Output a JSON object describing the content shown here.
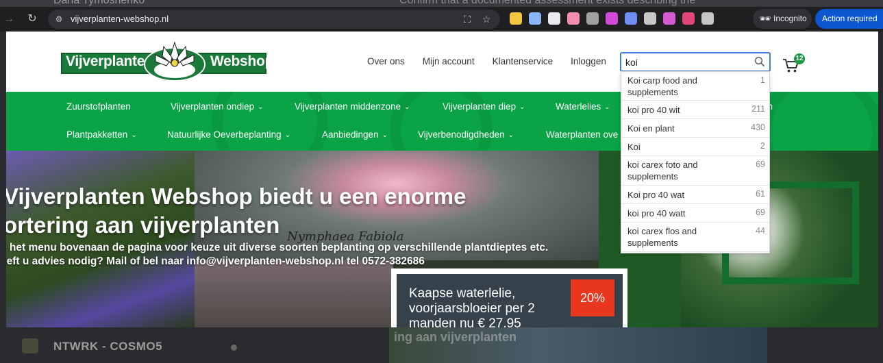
{
  "background": {
    "top_name": "Daria Tymoshenko",
    "top_snippet": "Confirm that a documented assessment exists describing the",
    "bottom_label": "NTWRK - COSMO5",
    "bottom_thumb_text": "ing aan vijverplanten"
  },
  "browser": {
    "url": "vijverplanten-webshop.nl",
    "incognito_label": "Incognito",
    "action_required_label": "Action required",
    "extension_colors": [
      "#f4c542",
      "#8ab4f8",
      "#e8eaed",
      "#f28cb1",
      "#a0a0a0",
      "#d24bd8",
      "#6f8df5",
      "#c6c6c6",
      "#d65ad1",
      "#e0457b",
      "#c6c6c6"
    ]
  },
  "header": {
    "logo_left": "Vijverplanten",
    "logo_right": "Webshop",
    "nav": {
      "about": "Over ons",
      "account": "Mijn account",
      "service": "Klantenservice",
      "login": "Inloggen"
    },
    "search_value": "koi",
    "cart_count": "12"
  },
  "menu": {
    "row1": [
      {
        "label": "Zuurstofplanten",
        "chevron": false
      },
      {
        "label": "Vijverplanten ondiep",
        "chevron": true
      },
      {
        "label": "Vijverplanten middenzone",
        "chevron": true
      },
      {
        "label": "Vijverplanten diep",
        "chevron": true
      },
      {
        "label": "Waterlelies",
        "chevron": true
      },
      {
        "label": "en",
        "chevron": false
      }
    ],
    "row2": [
      {
        "label": "Plantpakketten",
        "chevron": true
      },
      {
        "label": "Natuurlijke Oeverbeplanting",
        "chevron": true
      },
      {
        "label": "Aanbiedingen",
        "chevron": true
      },
      {
        "label": "Vijverbenodigdheden",
        "chevron": true
      },
      {
        "label": "Waterplanten ove",
        "chevron": false
      }
    ]
  },
  "hero": {
    "title_line1": "Vijverplanten Webshop biedt u een enorme",
    "title_line2": "ortering aan vijverplanten",
    "sub_line1": "e het menu bovenaan de pagina voor keuze uit diverse soorten beplanting op verschillende plantdieptes etc.",
    "sub_line2": "eeft u advies nodig? Mail of bel naar info@vijverplanten-webshop.nl  tel 0572-382686",
    "image_caption": "Nymphaea Fabiola",
    "promo_text": "Kaapse waterlelie, voorjaarsbloeier per 2 manden nu € 27,95",
    "promo_badge": "20%"
  },
  "suggestions": [
    {
      "text": "Koi carp food and supplements",
      "count": "1"
    },
    {
      "text": "koi pro 40 wit",
      "count": "211"
    },
    {
      "text": "Koi en plant",
      "count": "430"
    },
    {
      "text": "Koi",
      "count": "2"
    },
    {
      "text": "koi carex foto and supplements",
      "count": "69"
    },
    {
      "text": "Koi pro 40 wat",
      "count": "61"
    },
    {
      "text": "koi pro 40 watt",
      "count": "69"
    },
    {
      "text": "koi carex flos and supplements",
      "count": "44"
    }
  ]
}
